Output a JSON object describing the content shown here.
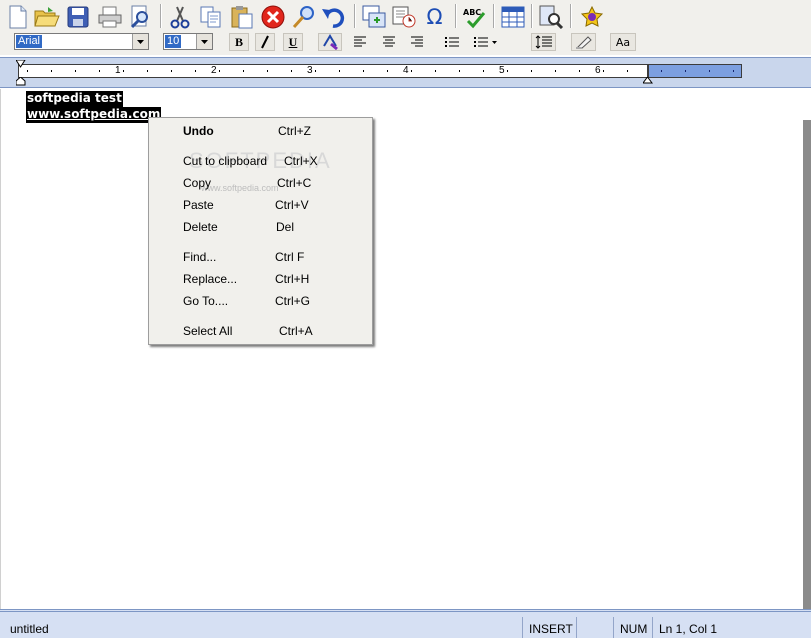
{
  "toolbar": {
    "buttons": [
      "new-file",
      "open-folder",
      "save",
      "print",
      "print-preview",
      "cut",
      "copy",
      "paste",
      "delete",
      "find",
      "undo",
      "insert-object",
      "insert-date",
      "insert-symbol",
      "spell-check",
      "table",
      "preview",
      "about"
    ]
  },
  "format": {
    "font_name": "Arial",
    "font_size": "10",
    "bold_label": "B",
    "italic_label": "I",
    "underline_label": "U",
    "case_label": "Aa"
  },
  "ruler": {
    "numbers": [
      "1",
      "2",
      "3",
      "4",
      "5",
      "6"
    ]
  },
  "document": {
    "line1": "softpedia test",
    "line2": "www.softpedia.com"
  },
  "context_menu": {
    "items": [
      {
        "label": "Undo",
        "shortcut": "Ctrl+Z"
      },
      {
        "label": "Cut to clipboard",
        "shortcut": "Ctrl+X"
      },
      {
        "label": "Copy",
        "shortcut": "Ctrl+C"
      },
      {
        "label": "Paste",
        "shortcut": "Ctrl+V"
      },
      {
        "label": "Delete",
        "shortcut": "Del"
      },
      {
        "label": "Find...",
        "shortcut": "Ctrl F"
      },
      {
        "label": "Replace...",
        "shortcut": "Ctrl+H"
      },
      {
        "label": "Go To....",
        "shortcut": "Ctrl+G"
      },
      {
        "label": "Select All",
        "shortcut": "Ctrl+A"
      }
    ]
  },
  "watermark": {
    "big": "SOFTPEDIA",
    "small": "www.softpedia.com"
  },
  "status": {
    "filename": "untitled",
    "mode": "INSERT",
    "num": "NUM",
    "position": "Ln 1, Col 1"
  },
  "colors": {
    "selection": "#000000",
    "ruler_bar": "#c9d6ec",
    "ruler_extent": "#7c9fe0",
    "status_bar": "#d6e0f3"
  }
}
